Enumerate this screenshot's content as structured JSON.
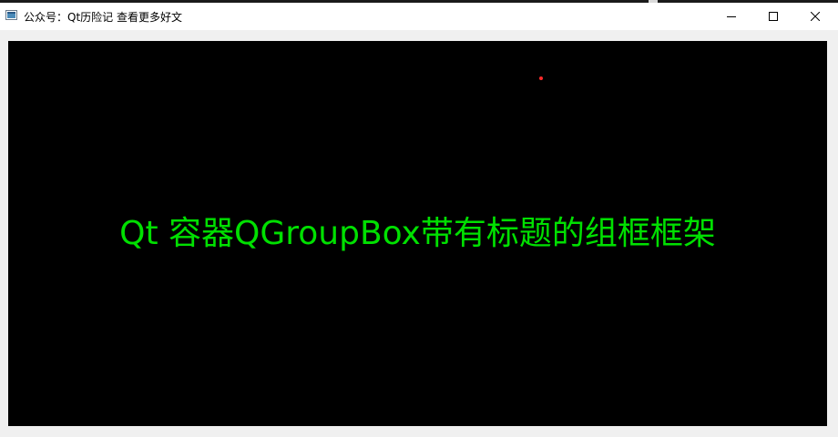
{
  "window": {
    "title": "公众号：Qt历险记 查看更多好文",
    "controls": {
      "minimize_icon": "minimize-icon",
      "maximize_icon": "maximize-icon",
      "close_icon": "close-icon"
    }
  },
  "content": {
    "headline": "Qt 容器QGroupBox带有标题的组框框架"
  },
  "colors": {
    "canvas_background": "#000000",
    "headline_text": "#00e000",
    "dot": "#ff2a2a"
  }
}
